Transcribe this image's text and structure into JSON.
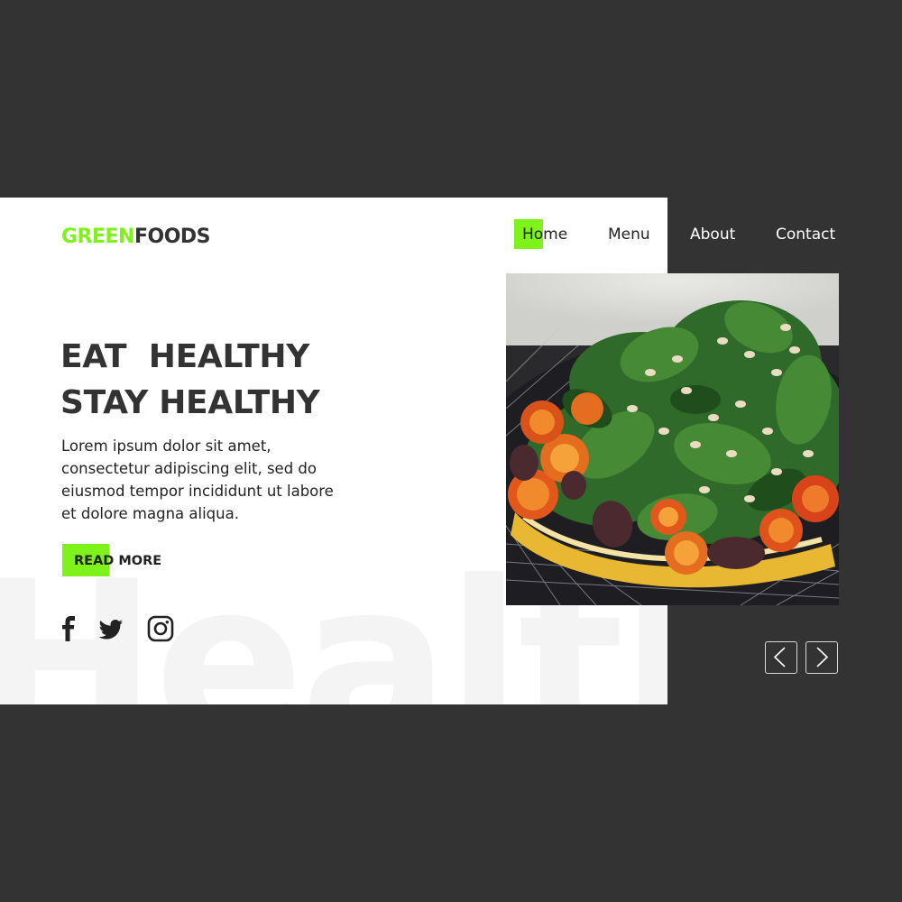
{
  "brand": {
    "name_part1": "GREEN",
    "name_part2": "FOODS",
    "accent_color": "#7ff21b"
  },
  "nav": {
    "items": [
      {
        "label": "Home",
        "active": true
      },
      {
        "label": "Menu"
      },
      {
        "label": "About"
      },
      {
        "label": "Contact"
      }
    ]
  },
  "hero": {
    "headline_line1": "EAT  HEALTHY",
    "headline_line2": "STAY HEALTHY",
    "body": "Lorem ipsum dolor sit amet, consectetur adipiscing elit, sed do eiusmod tempor incididunt ut labore et dolore magna aliqua.",
    "cta_label": "READ MORE",
    "watermark": "Healthy"
  },
  "social": {
    "icons": [
      "facebook-icon",
      "twitter-icon",
      "instagram-icon"
    ]
  },
  "slider": {
    "prev_icon": "chevron-left-icon",
    "next_icon": "chevron-right-icon"
  },
  "colors": {
    "dark_bg": "#333333",
    "panel_bg": "#ffffff",
    "text_dark": "#333333"
  }
}
